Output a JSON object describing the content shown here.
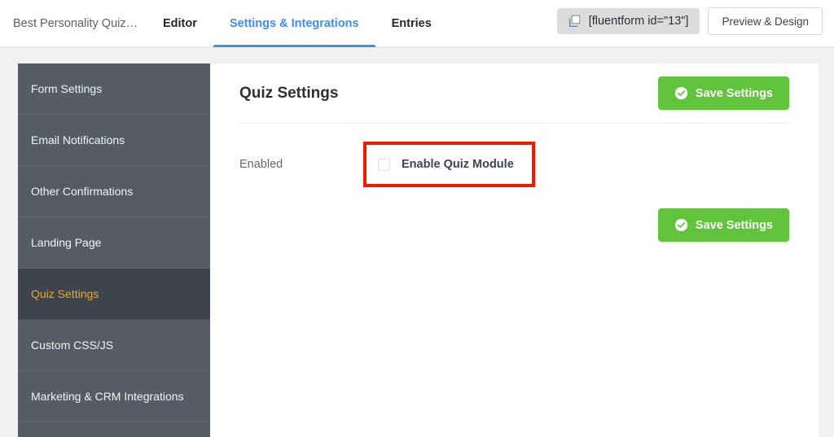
{
  "header": {
    "form_title": "Best Personality Quiz…",
    "tabs": [
      {
        "label": "Editor",
        "active": false
      },
      {
        "label": "Settings & Integrations",
        "active": true
      },
      {
        "label": "Entries",
        "active": false
      }
    ],
    "shortcode": {
      "icon": "copy-icon",
      "text": "[fluentform id=\"13\"]"
    },
    "preview_button": "Preview & Design"
  },
  "sidebar": {
    "items": [
      {
        "label": "Form Settings",
        "active": false
      },
      {
        "label": "Email Notifications",
        "active": false
      },
      {
        "label": "Other Confirmations",
        "active": false
      },
      {
        "label": "Landing Page",
        "active": false
      },
      {
        "label": "Quiz Settings",
        "active": true
      },
      {
        "label": "Custom CSS/JS",
        "active": false
      },
      {
        "label": "Marketing & CRM Integrations",
        "active": false
      }
    ]
  },
  "main": {
    "title": "Quiz Settings",
    "save_top_label": "Save Settings",
    "save_bottom_label": "Save Settings",
    "save_icon": "check-circle-icon",
    "enabled_row": {
      "label": "Enabled",
      "checkbox_label": "Enable Quiz Module",
      "checked": false
    }
  },
  "colors": {
    "accent_blue": "#3e8ef7",
    "save_green": "#62c43c",
    "sidebar_bg": "#545c66",
    "sidebar_active_bg": "#3d444e",
    "sidebar_active_text": "#f0a818",
    "highlight_red": "#f51800",
    "page_bg": "#f1f1f1"
  }
}
